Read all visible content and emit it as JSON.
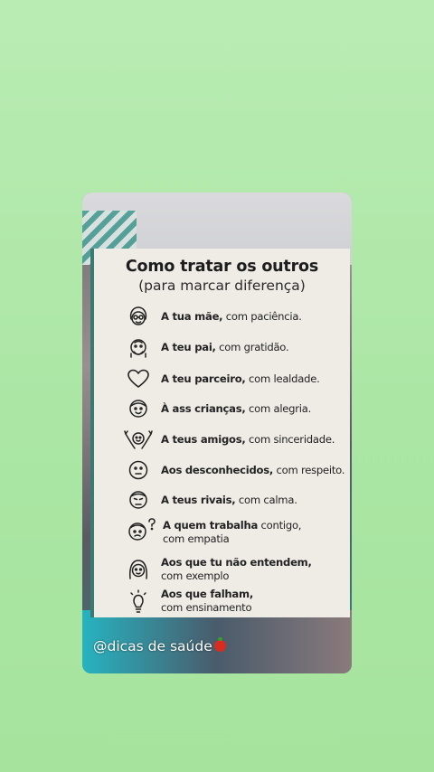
{
  "poster": {
    "title": "Como tratar os outros",
    "subtitle": "(para marcar diferença)",
    "items": [
      {
        "icon": "mother-face-icon",
        "bold": "A tua mãe,",
        "rest": " com paciência.",
        "line2": ""
      },
      {
        "icon": "father-face-icon",
        "bold": "A teu pai,",
        "rest": " com gratidão.",
        "line2": ""
      },
      {
        "icon": "heart-icon",
        "bold": "A teu parceiro,",
        "rest": " com lealdade.",
        "line2": ""
      },
      {
        "icon": "child-face-icon",
        "bold": "À ass crianças,",
        "rest": " com alegria.",
        "line2": ""
      },
      {
        "icon": "friends-hug-icon",
        "bold": "A teus amigos,",
        "rest": " com sinceridade.",
        "line2": ""
      },
      {
        "icon": "neutral-face-icon",
        "bold": "Aos desconhecidos,",
        "rest": " com respeito.",
        "line2": ""
      },
      {
        "icon": "rival-face-icon",
        "bold": "A teus rivais,",
        "rest": " com calma.",
        "line2": ""
      },
      {
        "icon": "question-face-icon",
        "bold": "A quem trabalha",
        "rest": " contigo,",
        "line2": "com empatia"
      },
      {
        "icon": "woman-face-icon",
        "bold": "Aos que tu não entendem,",
        "rest": "",
        "line2": "com exemplo"
      },
      {
        "icon": "lightbulb-icon",
        "bold": "Aos que falham,",
        "rest": "",
        "line2": "com ensinamento"
      }
    ]
  },
  "watermark": {
    "text": "@dicas de saúde",
    "emoji_icon": "tomato-icon"
  }
}
